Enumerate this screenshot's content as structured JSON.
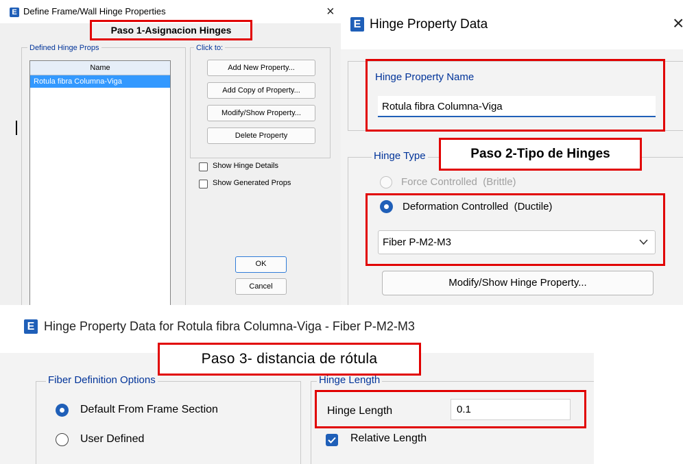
{
  "p1": {
    "title": "Define Frame/Wall Hinge Properties",
    "close": "×",
    "step_label": "Paso 1-Asignacion Hinges",
    "defined_group": "Defined Hinge Props",
    "list_header": "Name",
    "list_items": [
      "Rotula fibra Columna-Viga"
    ],
    "click_group": "Click to:",
    "buttons": {
      "add_new": "Add New Property...",
      "add_copy": "Add Copy of Property...",
      "modify": "Modify/Show Property...",
      "delete": "Delete Property"
    },
    "checkboxes": {
      "show_details": "Show Hinge Details",
      "show_generated": "Show Generated Props"
    },
    "ok": "OK",
    "cancel": "Cancel"
  },
  "p2": {
    "logo": "E",
    "title": "Hinge Property Data",
    "close": "×",
    "name_group": "Hinge Property Name",
    "name_value": "Rotula fibra Columna-Viga",
    "type_group": "Hinge Type",
    "step_label": "Paso 2-Tipo de Hinges",
    "force_label": "Force Controlled  (Brittle)",
    "deformation_label": "Deformation Controlled  (Ductile)",
    "select_value": "Fiber P-M2-M3",
    "modify_button": "Modify/Show Hinge Property..."
  },
  "p3": {
    "logo": "E",
    "title": "Hinge Property Data for Rotula fibra Columna-Viga - Fiber P-M2-M3",
    "step_label": "Paso 3- distancia de rótula",
    "fiber_group": "Fiber Definition Options",
    "default_option": "Default From Frame Section",
    "user_option": "User Defined",
    "hinge_group": "Hinge Length",
    "hinge_length_label": "Hinge Length",
    "hinge_length_value": "0.1",
    "relative_label": "Relative Length"
  },
  "colors": {
    "accent": "#1f5fb8",
    "highlight_red": "#e10000",
    "selection": "#3399ff",
    "dialog_bg": "#f0f0f0"
  }
}
